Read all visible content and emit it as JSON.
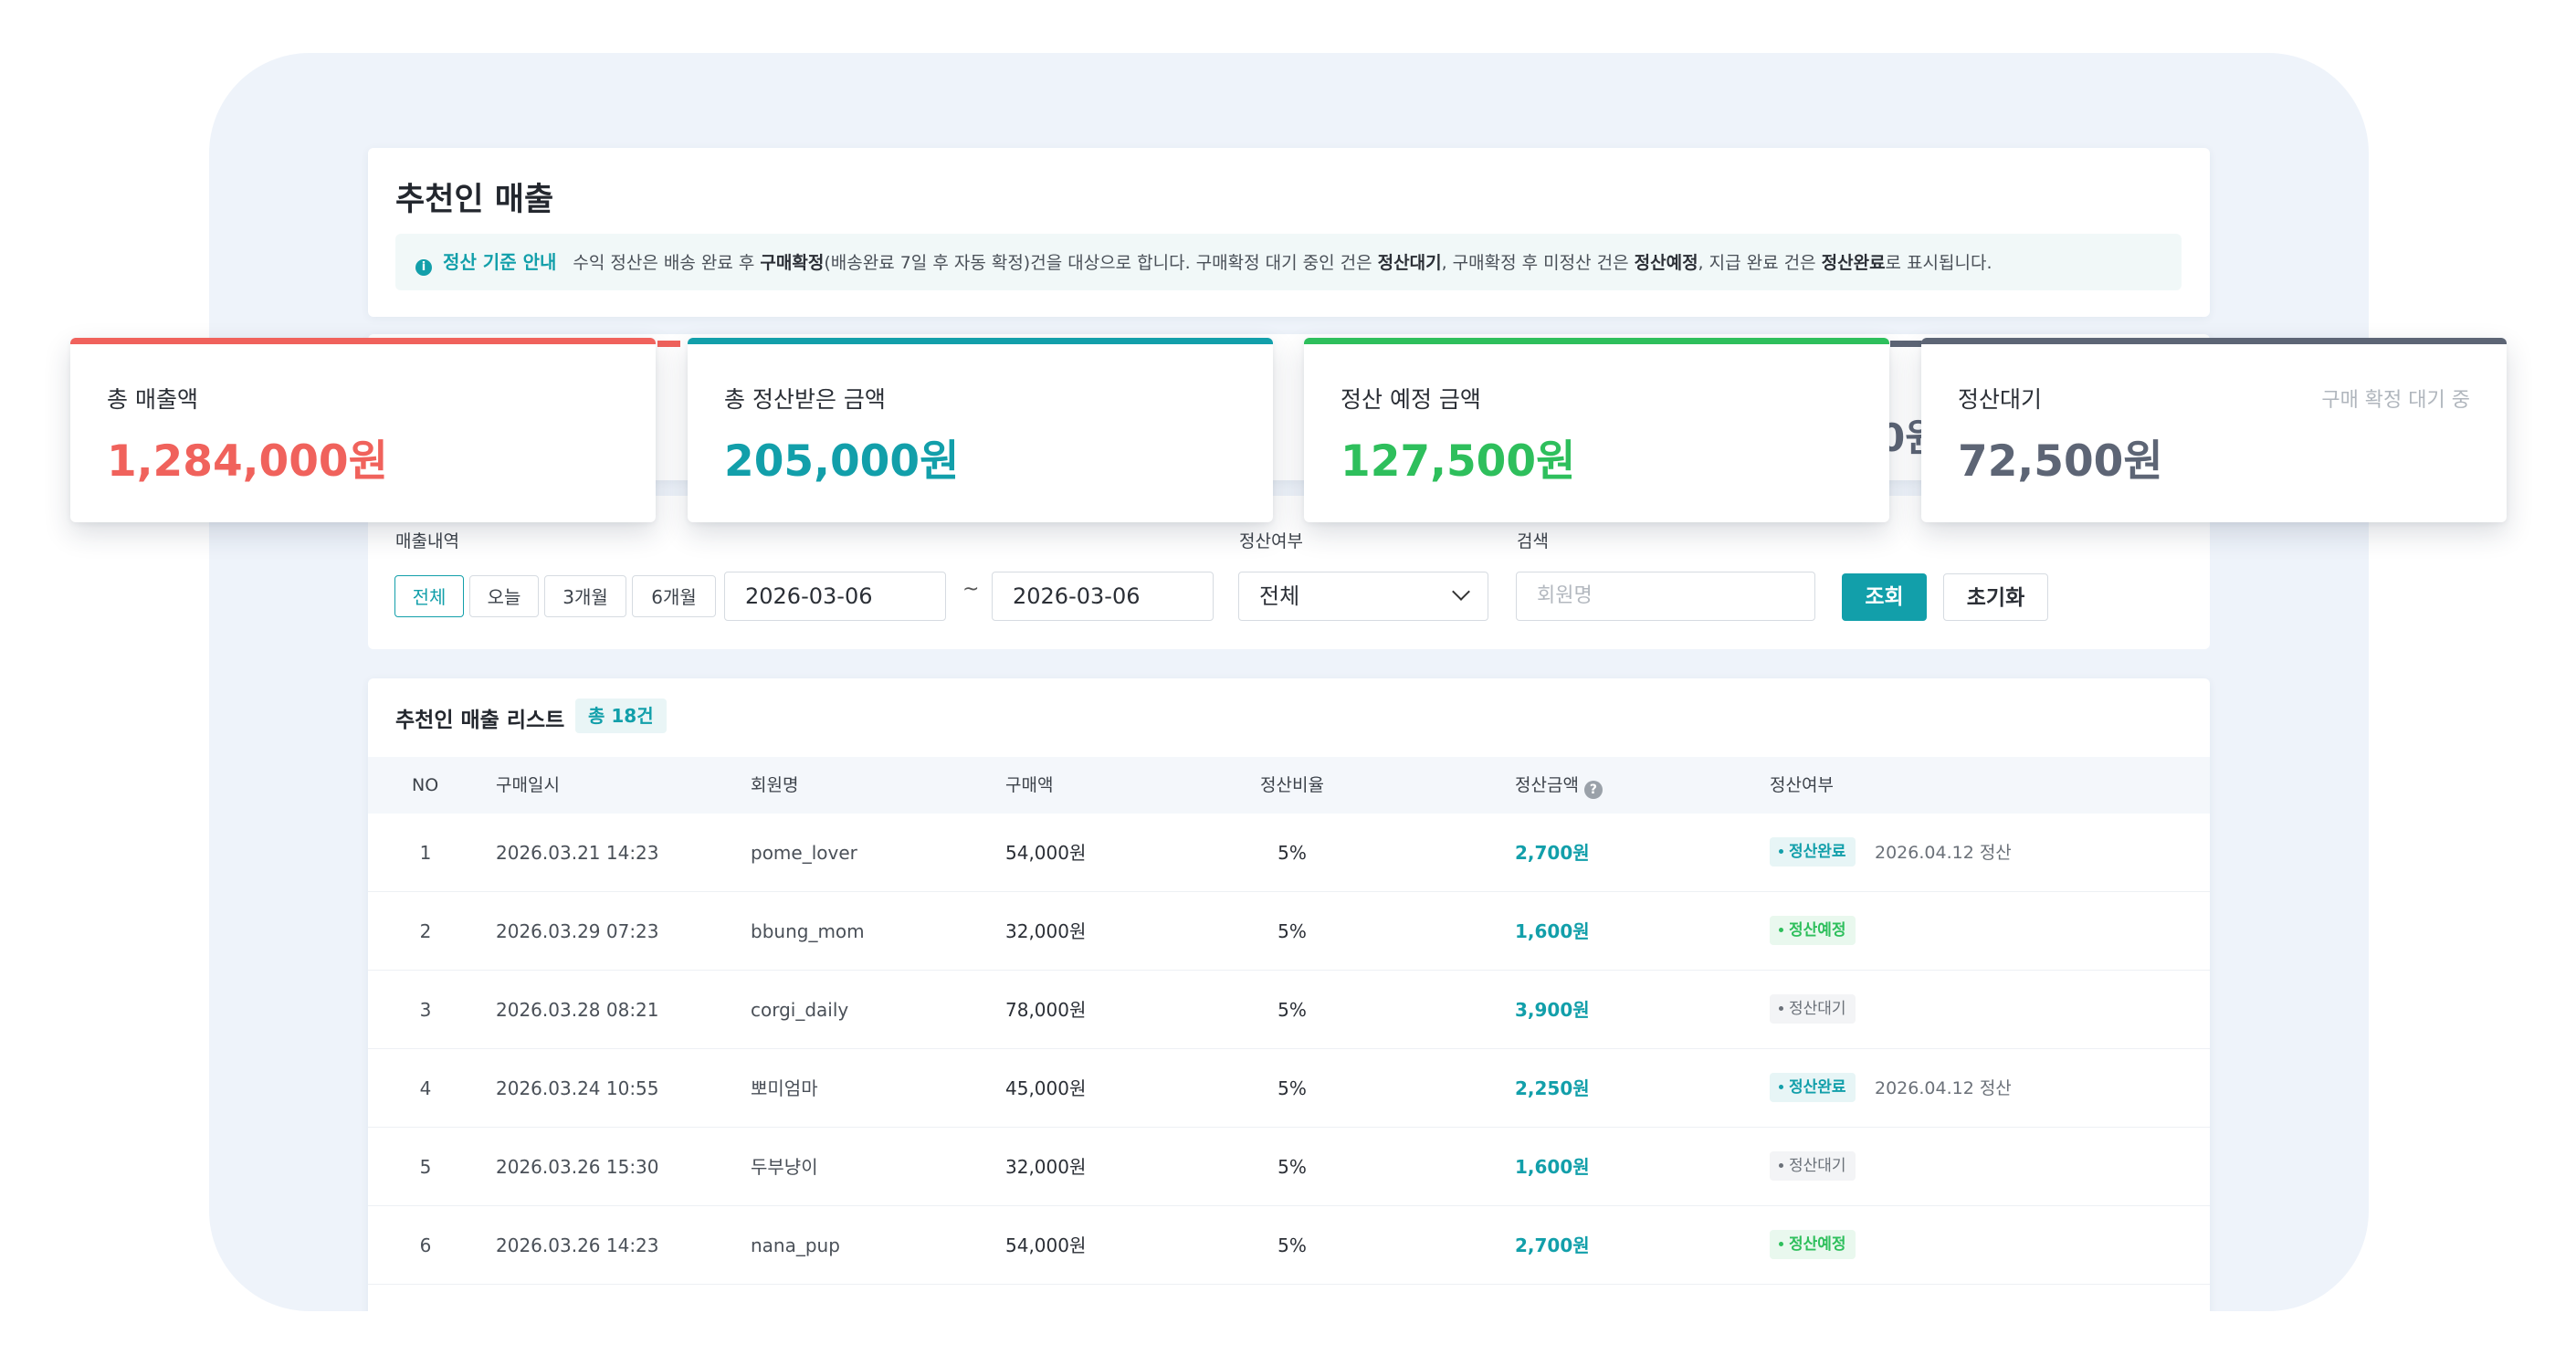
{
  "page": {
    "title": "추천인 매출",
    "notice": {
      "icon": "info-icon",
      "heading": "정산 기준 안내",
      "text_1": "수익 정산은 배송 완료 후 ",
      "bold_1": "구매확정",
      "text_2": "(배송완료 7일 후 자동 확정)건을 대상으로 합니다. 구매확정 대기 중인 건은 ",
      "bold_2": "정산대기",
      "text_3": ", 구매확정 후 미정산 건은 ",
      "bold_3": "정산예정",
      "text_4": ", 지급 완료 건은 ",
      "bold_4": "정산완료",
      "text_5": "로 표시됩니다."
    }
  },
  "cards": [
    {
      "label": "총 매출액",
      "value": "1,284,000원",
      "color": "#f0625c"
    },
    {
      "label": "총 정산받은 금액",
      "value": "205,000원",
      "color": "#129faa"
    },
    {
      "label": "정산 예정 금액",
      "value": "127,500원",
      "color": "#2ebf5c"
    },
    {
      "label": "정산대기",
      "value": "72,500원",
      "note": "구매 확정 대기 중",
      "color": "#5d6575"
    }
  ],
  "peek_text": "0원",
  "filters": {
    "period_label": "매출내역",
    "period_chips": [
      "전체",
      "오늘",
      "3개월",
      "6개월"
    ],
    "active_chip": "전체",
    "date_from": "2026-03-06",
    "date_separator": "~",
    "date_to": "2026-03-06",
    "status_label": "정산여부",
    "status_value": "전체",
    "search_label": "검색",
    "search_placeholder": "회원명",
    "search_button": "조회",
    "reset_button": "초기화"
  },
  "list": {
    "title": "추천인 매출 리스트",
    "count": "총 18건",
    "columns": [
      "NO",
      "구매일시",
      "회원명",
      "구매액",
      "정산비율",
      "정산금액",
      "정산여부"
    ],
    "rows": [
      {
        "no": "1",
        "date": "2026.03.21 14:23",
        "member": "pome_lover",
        "amount": "54,000원",
        "rate": "5%",
        "settle": "2,700원",
        "status": "정산완료",
        "status_type": "done",
        "settle_date": "2026.04.12 정산"
      },
      {
        "no": "2",
        "date": "2026.03.29 07:23",
        "member": "bbung_mom",
        "amount": "32,000원",
        "rate": "5%",
        "settle": "1,600원",
        "status": "정산예정",
        "status_type": "plan",
        "settle_date": ""
      },
      {
        "no": "3",
        "date": "2026.03.28 08:21",
        "member": "corgi_daily",
        "amount": "78,000원",
        "rate": "5%",
        "settle": "3,900원",
        "status": "정산대기",
        "status_type": "wait",
        "settle_date": ""
      },
      {
        "no": "4",
        "date": "2026.03.24 10:55",
        "member": "뽀미엄마",
        "amount": "45,000원",
        "rate": "5%",
        "settle": "2,250원",
        "status": "정산완료",
        "status_type": "done",
        "settle_date": "2026.04.12 정산"
      },
      {
        "no": "5",
        "date": "2026.03.26 15:30",
        "member": "두부냥이",
        "amount": "32,000원",
        "rate": "5%",
        "settle": "1,600원",
        "status": "정산대기",
        "status_type": "wait",
        "settle_date": ""
      },
      {
        "no": "6",
        "date": "2026.03.26 14:23",
        "member": "nana_pup",
        "amount": "54,000원",
        "rate": "5%",
        "settle": "2,700원",
        "status": "정산예정",
        "status_type": "plan",
        "settle_date": ""
      }
    ]
  }
}
